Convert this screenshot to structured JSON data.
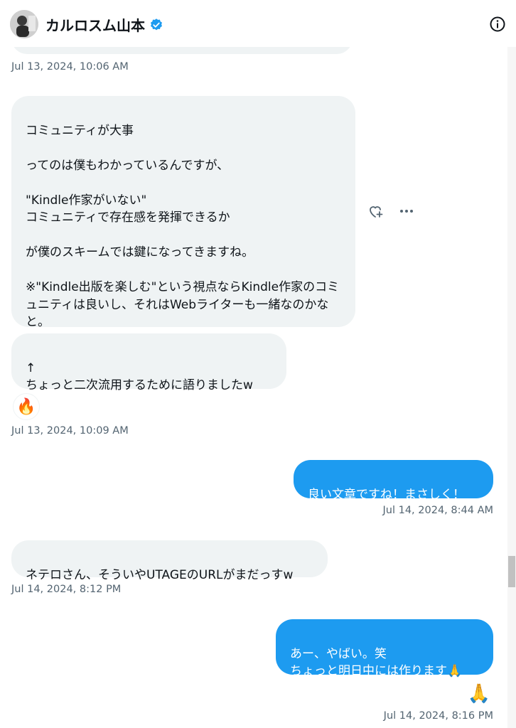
{
  "header": {
    "name": "カルロスム山本",
    "verified_color": "#1d9bf0",
    "info_icon": "info-icon"
  },
  "messages": [
    {
      "id": "m1",
      "direction": "in",
      "text": "コミュニティが大事\n\nってのは僕もわかっているんですが、\n\n\"Kindle作家がいない\"\nコミュニティで存在感を発揮できるか\n\nが僕のスキームでは鍵になってきますね。\n\n※\"Kindle出版を楽しむ\"という視点ならKindle作家のコミュニティは良いし、それはWebライターも一緒なのかなと。"
    },
    {
      "id": "m2",
      "direction": "in",
      "text": "↑\nちょっと二次流用するために語りましたw"
    },
    {
      "id": "m3",
      "direction": "out",
      "text": "良い文章ですね！まさしく！"
    },
    {
      "id": "m4",
      "direction": "in",
      "text": "ネテロさん、そういやUTAGEのURLがまだっすw"
    },
    {
      "id": "m5",
      "direction": "out",
      "text": "あー、やばい。笑\nちょっと明日中には作ります🙏"
    }
  ],
  "timestamps": {
    "t1": "Jul 13, 2024, 10:06 AM",
    "t2": "Jul 13, 2024, 10:09 AM",
    "t3": "Jul 14, 2024, 8:44 AM",
    "t4": "Jul 14, 2024, 8:12 PM",
    "t5": "Jul 14, 2024, 8:16 PM"
  },
  "reactions": {
    "r1": "🔥",
    "r2": "🙏"
  },
  "actions": {
    "react_icon": "heart-plus-icon",
    "more_icon": "more-icon"
  },
  "colors": {
    "incoming_bubble": "#eff3f4",
    "outgoing_bubble": "#1d9bf0",
    "timestamp": "#536471"
  }
}
